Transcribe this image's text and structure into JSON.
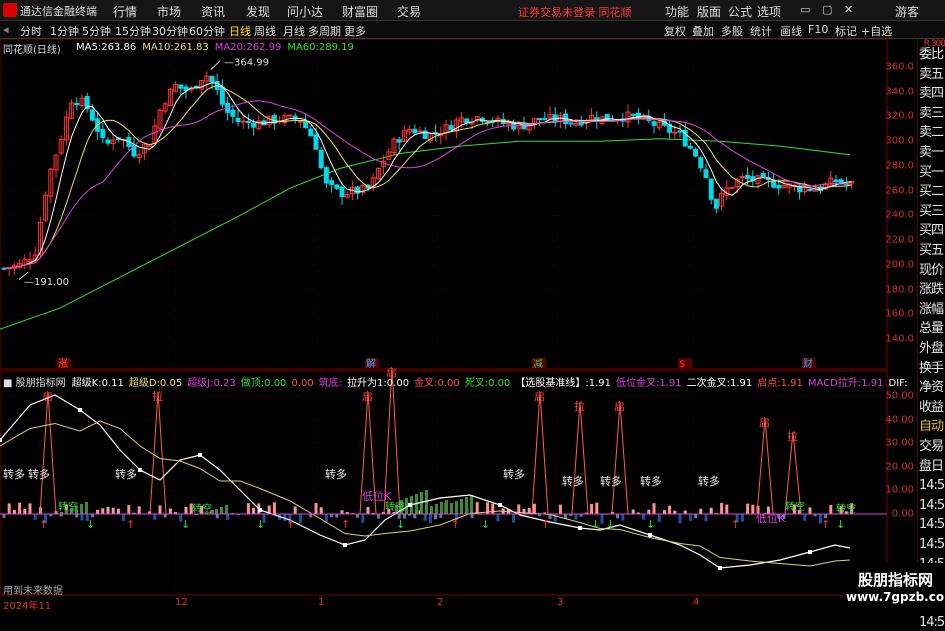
{
  "app": {
    "title": "通达信金融终端"
  },
  "menu": [
    "行情",
    "市场",
    "资讯",
    "发现",
    "问小达",
    "财富圈",
    "交易"
  ],
  "warning": "证券交易未登录 同花顺",
  "right_menu": [
    "功能",
    "版面",
    "公式",
    "选项",
    "游客"
  ],
  "toolbar": {
    "items": [
      "分时",
      "1分钟",
      "5分钟",
      "15分钟",
      "30分钟",
      "60分钟",
      "日线",
      "周线",
      "月线",
      "多周期",
      "更多"
    ],
    "active": "日线",
    "right": [
      "复权",
      "叠加",
      "多股",
      "统计",
      "画线",
      "F10",
      "标记",
      "+自选"
    ]
  },
  "stock": {
    "name": "同花顺(日线)"
  },
  "ma": [
    {
      "label": "MA5:",
      "value": "263.86",
      "color": "#ffffff"
    },
    {
      "label": "MA10:",
      "value": "261.83",
      "color": "#f0e060"
    },
    {
      "label": "MA20:",
      "value": "262.99",
      "color": "#e040e0"
    },
    {
      "label": "MA60:",
      "value": "289.19",
      "color": "#30e030"
    }
  ],
  "price_marks": {
    "high": "364.99",
    "low": "191.00"
  },
  "price_axis": [
    "360.0",
    "340.0",
    "320.0",
    "300.0",
    "280.0",
    "260.0",
    "240.0",
    "220.0",
    "200.0",
    "180.0",
    "160.0",
    "140.0"
  ],
  "event_tags": [
    {
      "text": "涨",
      "color": "#ff4040"
    },
    {
      "text": "解",
      "color": "#40a0ff"
    },
    {
      "text": "减",
      "color": "#40c040"
    },
    {
      "text": "$",
      "color": "#ff3030"
    },
    {
      "text": "财",
      "color": "#40a0ff"
    }
  ],
  "indicator": {
    "name": "股朋指标网",
    "items": [
      {
        "label": "超级K:",
        "value": "0.11",
        "color": "#ffffff"
      },
      {
        "label": "超级D:",
        "value": "0.05",
        "color": "#f0e060"
      },
      {
        "label": "超级J:",
        "value": "0.23",
        "color": "#e040e0"
      },
      {
        "label": "做顶:",
        "value": "0.00",
        "color": "#30e030"
      },
      {
        "label": "",
        "value": "0.00",
        "color": "#ff5050"
      },
      {
        "label": "筑底:",
        "value": "",
        "color": "#e040e0"
      },
      {
        "label": "拉升为1:",
        "value": "0.00",
        "color": "#ffffff"
      },
      {
        "label": "金叉:",
        "value": "0.00",
        "color": "#ff5050"
      },
      {
        "label": "死叉:",
        "value": "0.00",
        "color": "#30e030"
      },
      {
        "label": "【选股基准线】:",
        "value": "1.91",
        "color": "#ffffff"
      },
      {
        "label": "低位金叉:",
        "value": "1.91",
        "color": "#e040e0"
      },
      {
        "label": "二次金叉:",
        "value": "1.91",
        "color": "#ffffff"
      },
      {
        "label": "启点:",
        "value": "1.91",
        "color": "#ff5050"
      },
      {
        "label": "MACD拉升:",
        "value": "1.91",
        "color": "#e040e0"
      },
      {
        "label": "DIF:",
        "value": "",
        "color": "#ffffff"
      }
    ],
    "axis": [
      "50.00",
      "40.00",
      "30.00",
      "20.00",
      "10.00",
      "0.00"
    ],
    "signals": {
      "qi": "启",
      "la": "拉",
      "zhuanduo": "转多",
      "diweiK": "低位K",
      "zhuankong": "转空"
    },
    "footer": "用到未来数据"
  },
  "dates": [
    "2024年11",
    "12",
    "1",
    "2",
    "3",
    "4"
  ],
  "side": [
    {
      "t": "委比",
      "y": false
    },
    {
      "t": "卖五",
      "y": false
    },
    {
      "t": "卖四",
      "y": false
    },
    {
      "t": "卖三",
      "y": false
    },
    {
      "t": "卖二",
      "y": false
    },
    {
      "t": "卖一",
      "y": false
    },
    {
      "t": "买一",
      "y": false
    },
    {
      "t": "买二",
      "y": false
    },
    {
      "t": "买三",
      "y": false
    },
    {
      "t": "买四",
      "y": false
    },
    {
      "t": "买五",
      "y": false
    },
    {
      "t": "现价",
      "y": false
    },
    {
      "t": "涨跌",
      "y": false
    },
    {
      "t": "涨幅",
      "y": false
    },
    {
      "t": "总量",
      "y": false
    },
    {
      "t": "外盘",
      "y": false
    },
    {
      "t": "换手",
      "y": false
    },
    {
      "t": "净资",
      "y": false
    },
    {
      "t": "收益",
      "y": false
    },
    {
      "t": "自动",
      "y": true
    },
    {
      "t": "交易",
      "y": false
    },
    {
      "t": "盘日",
      "y": false
    },
    {
      "t": "14:5",
      "y": false
    },
    {
      "t": "14:5",
      "y": false
    },
    {
      "t": "14:5",
      "y": false
    },
    {
      "t": "14:5",
      "y": false
    },
    {
      "t": "14:5",
      "y": false
    },
    {
      "t": "14:5",
      "y": false
    },
    {
      "t": "14:5",
      "y": false
    },
    {
      "t": "14:5",
      "y": false
    }
  ],
  "side_top": [
    "R",
    "300"
  ],
  "watermark": {
    "line1": "股朋指标网",
    "line2": "www.7gpzb.com"
  }
}
